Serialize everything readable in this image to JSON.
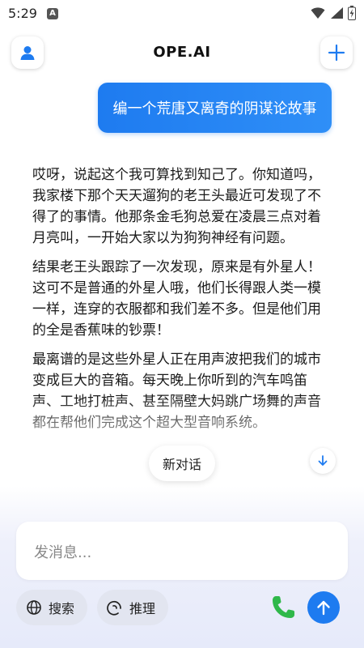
{
  "status_bar": {
    "time": "5:29",
    "notif_letter": "A"
  },
  "header": {
    "title": "OPE.AI"
  },
  "conversation": {
    "user_message": "编一个荒唐又离奇的阴谋论故事",
    "assistant_paragraphs": [
      "哎呀，说起这个我可算找到知己了。你知道吗，我家楼下那个天天遛狗的老王头最近可发现了不得了的事情。他那条金毛狗总爱在凌晨三点对着月亮叫，一开始大家以为狗狗神经有问题。",
      "结果老王头跟踪了一次发现，原来是有外星人！这可不是普通的外星人哦，他们长得跟人类一模一样，连穿的衣服都和我们差不多。但是他们用的全是香蕉味的钞票！",
      "最离谱的是这些外星人正在用声波把我们的城市变成巨大的音箱。每天晚上你听到的汽车鸣笛声、工地打桩声、甚至隔壁大妈跳广场舞的声音都在帮他们完成这个超大型音响系统。"
    ]
  },
  "new_chat_label": "新对话",
  "composer": {
    "placeholder": "发消息...",
    "search_label": "搜索",
    "reason_label": "推理"
  },
  "colors": {
    "accent": "#1e7bf0",
    "phone_green": "#2fb84a"
  }
}
